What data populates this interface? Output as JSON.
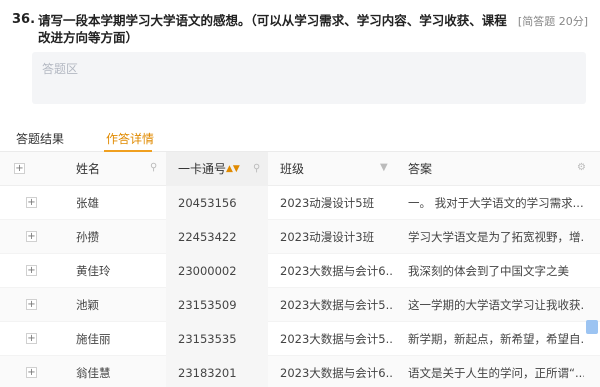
{
  "question": {
    "number": "36.",
    "text": "请写一段本学期学习大学语文的感想。（可以从学习需求、学习内容、学习收获、课程改进方向等方面）",
    "tag": "[简答题 20分]"
  },
  "answer_placeholder": "答题区",
  "tabs": [
    {
      "label": "答题结果"
    },
    {
      "label": "作答详情"
    }
  ],
  "table": {
    "headers": {
      "expand": "+",
      "name": "姓名",
      "card": "一卡通号",
      "class": "班级",
      "answer": "答案"
    },
    "rows": [
      {
        "name": "张雄",
        "card": "20453156",
        "class": "2023动漫设计5班",
        "answer": "一。 我对于大学语文的学习需求..."
      },
      {
        "name": "孙攒",
        "card": "22453422",
        "class": "2023动漫设计3班",
        "answer": "学习大学语文是为了拓宽视野，增..."
      },
      {
        "name": "黄佳玲",
        "card": "23000002",
        "class": "2023大数据与会计6...",
        "answer": "我深刻的体会到了中国文字之美"
      },
      {
        "name": "池颖",
        "card": "23153509",
        "class": "2023大数据与会计5...",
        "answer": "这一学期的大学语文学习让我收获..."
      },
      {
        "name": "施佳丽",
        "card": "23153535",
        "class": "2023大数据与会计5...",
        "answer": "新学期，新起点，新希望，希望自..."
      },
      {
        "name": "翁佳慧",
        "card": "23183201",
        "class": "2023大数据与会计6...",
        "answer": "语文是关于人生的学问，正所谓“..."
      }
    ]
  }
}
